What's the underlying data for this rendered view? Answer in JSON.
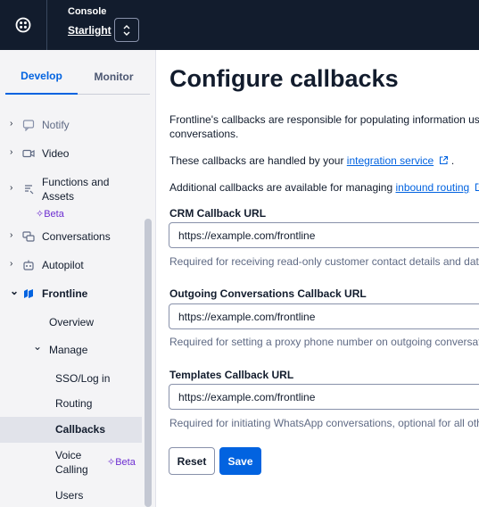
{
  "topbar": {
    "console_label": "Console",
    "account_name": "Starlight"
  },
  "sidebar": {
    "tabs": [
      {
        "label": "Develop",
        "active": true
      },
      {
        "label": "Monitor",
        "active": false
      }
    ],
    "items": [
      {
        "label": "Notify",
        "icon": "notify-icon",
        "chevron": "›"
      },
      {
        "label": "Video",
        "icon": "video-icon",
        "chevron": "›"
      },
      {
        "label": "Functions and",
        "label2": "Assets",
        "icon": "functions-icon",
        "chevron": "›",
        "badge": "Beta"
      },
      {
        "label": "Conversations",
        "icon": "conversations-icon",
        "chevron": "›"
      },
      {
        "label": "Autopilot",
        "icon": "autopilot-icon",
        "chevron": "›"
      },
      {
        "label": "Frontline",
        "icon": "frontline-icon",
        "chevron": "⌄"
      }
    ],
    "frontline_sub": {
      "overview": "Overview",
      "manage": "Manage",
      "manage_items": [
        "SSO/Log in",
        "Routing",
        "Callbacks",
        "Voice",
        "Calling",
        "Users"
      ],
      "voice_badge": "Beta"
    }
  },
  "main": {
    "title": "Configure callbacks",
    "intro_line1": "Frontline's callbacks are responsible for populating information used",
    "intro_line2": "conversations.",
    "handled_prefix": "These callbacks are handled by your ",
    "handled_link": "integration service",
    "handled_suffix": " .",
    "additional_prefix": "Additional callbacks are available for managing ",
    "additional_link": "inbound routing",
    "fields": [
      {
        "label": "CRM Callback URL",
        "value": "https://example.com/frontline",
        "help": "Required for receiving read-only customer contact details and data"
      },
      {
        "label": "Outgoing Conversations Callback URL",
        "value": "https://example.com/frontline",
        "help": "Required for setting a proxy phone number on outgoing conversatio"
      },
      {
        "label": "Templates Callback URL",
        "value": "https://example.com/frontline",
        "help": "Required for initiating WhatsApp conversations, optional for all othe"
      }
    ],
    "reset_label": "Reset",
    "save_label": "Save"
  },
  "colors": {
    "accent": "#0263e0",
    "topbar_bg": "#121c2d",
    "beta": "#6d2ed1"
  }
}
